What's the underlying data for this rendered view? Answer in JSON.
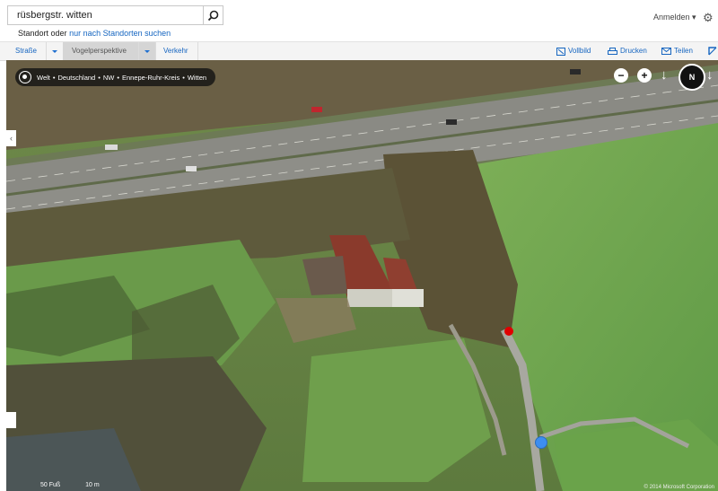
{
  "search": {
    "value": "rüsbergstr. witten"
  },
  "hint": {
    "prefix": "Standort oder",
    "link": "nur nach Standorten suchen"
  },
  "header": {
    "signin": "Anmelden ▾"
  },
  "toolbar": {
    "road": "Straße",
    "birdseye": "Vogelperspektive",
    "traffic": "Verkehr",
    "fullscreen": "Vollbild",
    "print": "Drucken",
    "share": "Teilen"
  },
  "map": {
    "breadcrumb": [
      "Welt",
      "Deutschland",
      "NW",
      "Ennepe-Ruhr-Kreis",
      "Witten"
    ],
    "compass_label": "N",
    "scale_left": "50 Fuß",
    "scale_right": "10 m",
    "copyright": "© 2014 Microsoft Corporation"
  },
  "colors": {
    "link": "#1565c0",
    "red_pin": "#e00000",
    "blue_pin": "#3d8ef0"
  }
}
